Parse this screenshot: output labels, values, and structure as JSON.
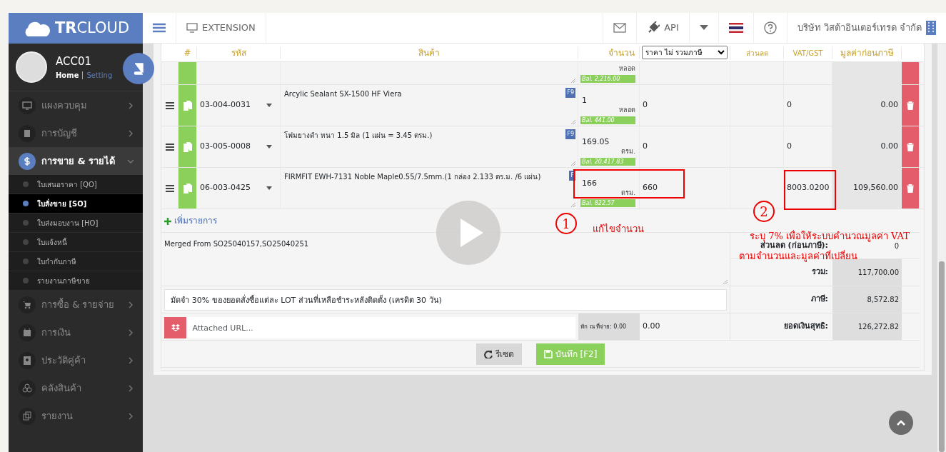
{
  "app": {
    "logo": "**TR**CLOUD"
  },
  "header": {
    "extension": "EXTENSION",
    "api": "API",
    "company": "บริษัท วิสต้าอินเตอร์เทรด จำกัด"
  },
  "user": {
    "name": "ACC01",
    "home": "Home",
    "setting": "Setting"
  },
  "sidebar": {
    "items": [
      {
        "label": "แผงควบคุม",
        "expanded": false
      },
      {
        "label": "การบัญชี",
        "expanded": false
      },
      {
        "label": "การขาย & รายได้",
        "expanded": true,
        "children": [
          {
            "label": "ใบเสนอราคา [QO]",
            "selected": false
          },
          {
            "label": "ใบสั่งขาย [SO]",
            "selected": true
          },
          {
            "label": "ใบส่งมอบงาน [HO]",
            "selected": false
          },
          {
            "label": "ใบแจ้งหนี้",
            "selected": false
          },
          {
            "label": "ใบกำกับภาษี",
            "selected": false
          },
          {
            "label": "รายงานภาษีขาย",
            "selected": false
          }
        ]
      },
      {
        "label": "การซื้อ & รายจ่าย",
        "expanded": false
      },
      {
        "label": "การเงิน",
        "expanded": false
      },
      {
        "label": "ประวัติคู่ค้า",
        "expanded": false
      },
      {
        "label": "คลังสินค้า",
        "expanded": false
      },
      {
        "label": "รายงาน",
        "expanded": false
      }
    ]
  },
  "table": {
    "columns": [
      {
        "kind": "text",
        "label": "#"
      },
      {
        "kind": "text",
        "label": "รหัส"
      },
      {
        "kind": "text",
        "label": "สินค้า"
      },
      {
        "kind": "text",
        "label": "จำนวน"
      },
      {
        "kind": "select",
        "label": "ราคา ไม่ รวมภาษี"
      },
      {
        "kind": "text",
        "label": "ส่วนลด"
      },
      {
        "kind": "text",
        "label": "VAT/GST"
      },
      {
        "kind": "text",
        "label": "มูลค่าก่อนภาษี"
      }
    ],
    "rows": [
      {
        "kind": "partial",
        "unit": "หลอด",
        "balance": "Bal. 2,216.00"
      },
      {
        "kind": "item",
        "code": "03-004-0031",
        "product": "Arcylic Sealant SX-1500 HF Viera",
        "badge": "F9",
        "qty": "1",
        "unit": "หลอด",
        "balance": "Bal. 441.00",
        "price": "0",
        "vat": "0",
        "pretax": "0.00"
      },
      {
        "kind": "item",
        "code": "03-005-0008",
        "product": "โฟมยางดำ หนา 1.5 มิล (1 แผ่น = 3.45 ตรม.)",
        "badge": "F9",
        "qty": "169.05",
        "unit": "ตรม.",
        "balance": "Bal. 20,417.83",
        "price": "0",
        "vat": "0",
        "pretax": "0.00"
      },
      {
        "kind": "item",
        "code": "06-003-0425",
        "product": "FIRMFIT EWH-7131 Noble Maple0.55/7.5mm.(1 กล่อง 2.133 ตร.ม. /6 แผ่น)",
        "badge": "F",
        "qty": "166",
        "unit": "ตรม.",
        "balance": "Bal. 822.57",
        "price": "660",
        "vat": "8003.0200",
        "pretax": "109,560.00"
      }
    ]
  },
  "add_item": "เพิ่มรายการ",
  "notes": "Merged From SO25040157,SO25040251",
  "remark": "มัดจำ 30% ของยอดสั่งซื้อแต่ละ LOT ส่วนที่เหลือชำระหลังติดตั้ง (เครดิต 30 วัน)",
  "attachment": {
    "placeholder": "Attached URL...",
    "withholding": "หัก ณ ที่จ่าย: 0.00",
    "withholding_value": "0.00"
  },
  "summary": [
    {
      "label": "ส่วนลด (ก่อนภาษี):",
      "value": "0",
      "shaded": false
    },
    {
      "label": "รวม:",
      "value": "117,700.00",
      "shaded": true
    },
    {
      "label": "ภาษี:",
      "value": "8,572.82",
      "shaded": true
    },
    {
      "label": "ยอดเงินสุทธิ:",
      "value": "126,272.82",
      "shaded": true
    }
  ],
  "buttons": [
    {
      "kind": "reset",
      "label": "รีเซต"
    },
    {
      "kind": "save",
      "label": "บันทึก [F2]"
    }
  ],
  "annotations": [
    {
      "number": "1",
      "text": "แก้ไขจำนวน"
    },
    {
      "number": "2",
      "text": "ระบุ 7% เพื่อให้ระบบคำนวณมูลค่า VAT",
      "text2": "ตามจำนวนและมูลค่าที่เปลี่ยน"
    }
  ]
}
